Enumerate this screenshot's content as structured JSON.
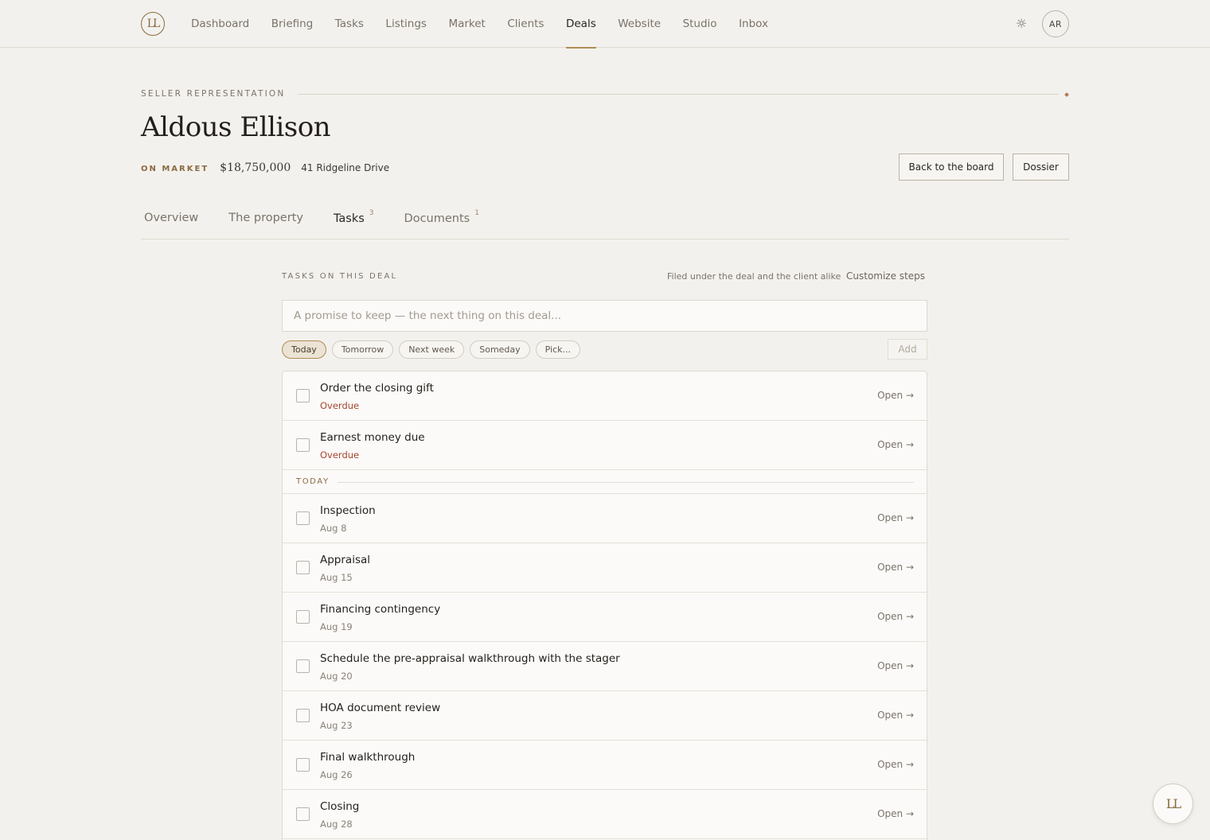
{
  "nav": {
    "logo": "LL",
    "links": [
      "Dashboard",
      "Briefing",
      "Tasks",
      "Listings",
      "Market",
      "Clients",
      "Deals",
      "Website",
      "Studio",
      "Inbox"
    ],
    "active": "Deals",
    "theme_icon": "sun-icon",
    "avatar_initials": "AR"
  },
  "header": {
    "eyebrow": "SELLER REPRESENTATION",
    "title": "Aldous Ellison",
    "status": "ON MARKET",
    "price": "$18,750,000",
    "address": "41 Ridgeline Drive",
    "back_button": "Back to the board",
    "dossier_button": "Dossier"
  },
  "tabs": [
    {
      "label": "Overview",
      "count": ""
    },
    {
      "label": "The property",
      "count": ""
    },
    {
      "label": "Tasks",
      "count": "3"
    },
    {
      "label": "Documents",
      "count": "1"
    }
  ],
  "active_tab": "Tasks",
  "tasks_section": {
    "label": "TASKS ON THIS DEAL",
    "note": "Filed under the deal and the client alike",
    "customize": "Customize steps",
    "input_placeholder": "A promise to keep — the next thing on this deal...",
    "input_value": "",
    "chips": [
      "Today",
      "Tomorrow",
      "Next week",
      "Someday",
      "Pick..."
    ],
    "active_chip": "Today",
    "add_label": "Add",
    "open_label": "Open →",
    "overdue": [
      {
        "title": "Order the closing gift",
        "sub": "Overdue"
      },
      {
        "title": "Earnest money due",
        "sub": "Overdue"
      }
    ],
    "group_label": "TODAY",
    "upcoming": [
      {
        "title": "Inspection",
        "sub": "Aug 8"
      },
      {
        "title": "Appraisal",
        "sub": "Aug 15"
      },
      {
        "title": "Financing contingency",
        "sub": "Aug 19"
      },
      {
        "title": "Schedule the pre-appraisal walkthrough with the stager",
        "sub": "Aug 20"
      },
      {
        "title": "HOA document review",
        "sub": "Aug 23"
      },
      {
        "title": "Final walkthrough",
        "sub": "Aug 26"
      },
      {
        "title": "Closing",
        "sub": "Aug 28"
      }
    ]
  },
  "fab": {
    "label": "LL"
  },
  "colors": {
    "accent": "#b08d57",
    "overdue": "#a5452f",
    "background": "#f3f1ed"
  }
}
